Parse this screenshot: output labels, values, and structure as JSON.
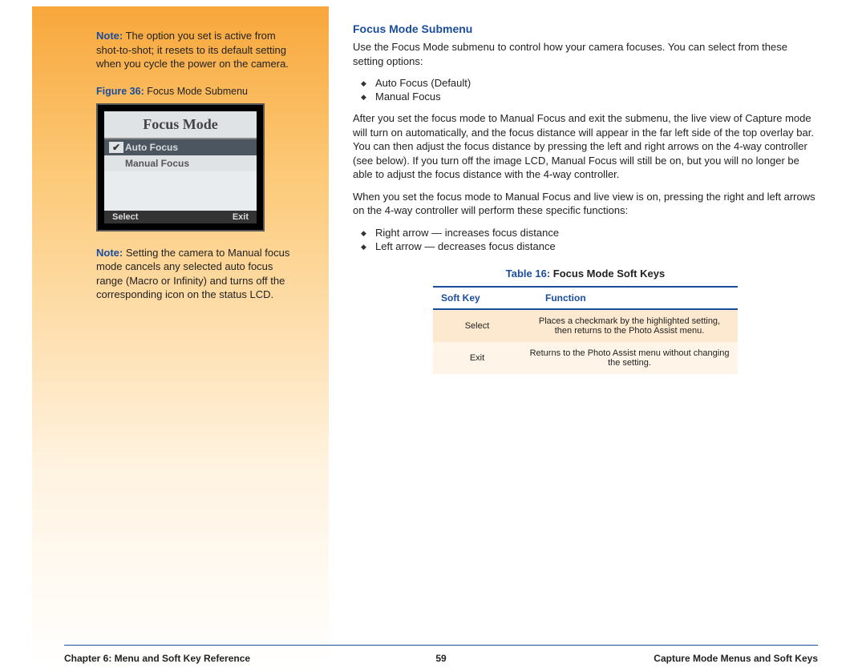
{
  "sidebar": {
    "note1_label": "Note:",
    "note1_text": " The option you set is active from shot-to-shot; it resets to its default setting when you cycle the power on the camera.",
    "figure_label": "Figure 36:",
    "figure_text": " Focus Mode Submenu",
    "lcd": {
      "title": "Focus Mode",
      "item1": "Auto Focus",
      "item2": "Manual Focus",
      "soft_left": "Select",
      "soft_right": "Exit"
    },
    "note2_label": "Note:",
    "note2_text": " Setting the camera to Manual focus mode cancels any selected auto focus range (Macro or Infinity) and turns off the corresponding icon on the status LCD."
  },
  "main": {
    "heading": "Focus Mode Submenu",
    "intro": "Use the Focus Mode submenu to control how your camera focuses. You can select from these setting options:",
    "options": {
      "0": "Auto Focus (Default)",
      "1": "Manual Focus"
    },
    "para2": "After you set the focus mode to Manual Focus and exit the submenu, the live view of Capture mode will turn on automatically, and the focus distance will appear in the far left side of the top overlay bar. You can then adjust the focus distance by pressing the left and right arrows on the 4-way controller (see below). If you turn off the image LCD, Manual Focus will still be on, but you will no longer be able to adjust the focus distance with the 4-way controller.",
    "para3": "When you set the focus mode to Manual Focus and live view is on, pressing the right and left arrows on the 4-way controller will perform these specific functions:",
    "arrows": {
      "0": "Right arrow — increases focus distance",
      "1": "Left arrow — decreases focus distance"
    },
    "table_label": "Table 16:",
    "table_text": " Focus Mode Soft Keys",
    "table": {
      "h1": "Soft Key",
      "h2": "Function",
      "r1c1": "Select",
      "r1c2": "Places a checkmark by the highlighted setting, then returns to the Photo Assist menu.",
      "r2c1": "Exit",
      "r2c2": "Returns to the Photo Assist menu without changing the setting."
    }
  },
  "footer": {
    "left": "Chapter 6: Menu and Soft Key Reference",
    "center": "59",
    "right": "Capture Mode Menus and Soft Keys"
  }
}
